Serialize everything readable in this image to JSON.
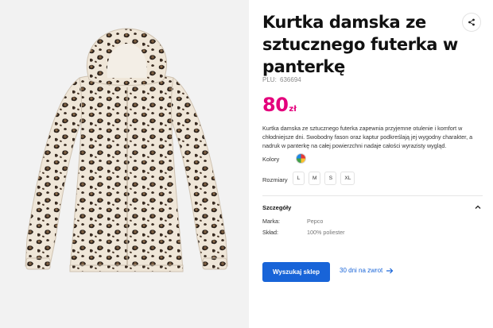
{
  "product": {
    "title": "Kurtka damska ze sztucznego futerka w panterkę",
    "plu_label": "PLU:",
    "plu_value": "636694",
    "price_amount": "80",
    "price_currency": "zł",
    "description": "Kurtka damska ze sztucznego futerka zapewnia przyjemne otulenie i komfort w chłodniejsze dni. Swobodny fason oraz kaptur podkreślają jej wygodny charakter, a nadruk w panterkę na całej powierzchni nadaje całości wyrazisty wygląd.",
    "image_icon": "leopard-print-jacket-image"
  },
  "colors": {
    "label": "Kolory",
    "swatch_icon": "multicolor-swatch-icon"
  },
  "sizes": {
    "label": "Rozmiary",
    "options": [
      "L",
      "M",
      "S",
      "XL"
    ]
  },
  "details": {
    "title": "Szczegóły",
    "toggle_icon": "chevron-up-icon",
    "rows": [
      {
        "label": "Marka:",
        "value": "Pepco"
      },
      {
        "label": "Skład:",
        "value": "100% poliester"
      }
    ]
  },
  "actions": {
    "find_store": "Wyszukaj sklep",
    "return_label": "30 dni na zwrot",
    "return_icon": "arrow-right-icon",
    "share_icon": "share-icon"
  },
  "colors_theme": {
    "price": "#e4007c",
    "primary": "#1864d8"
  }
}
